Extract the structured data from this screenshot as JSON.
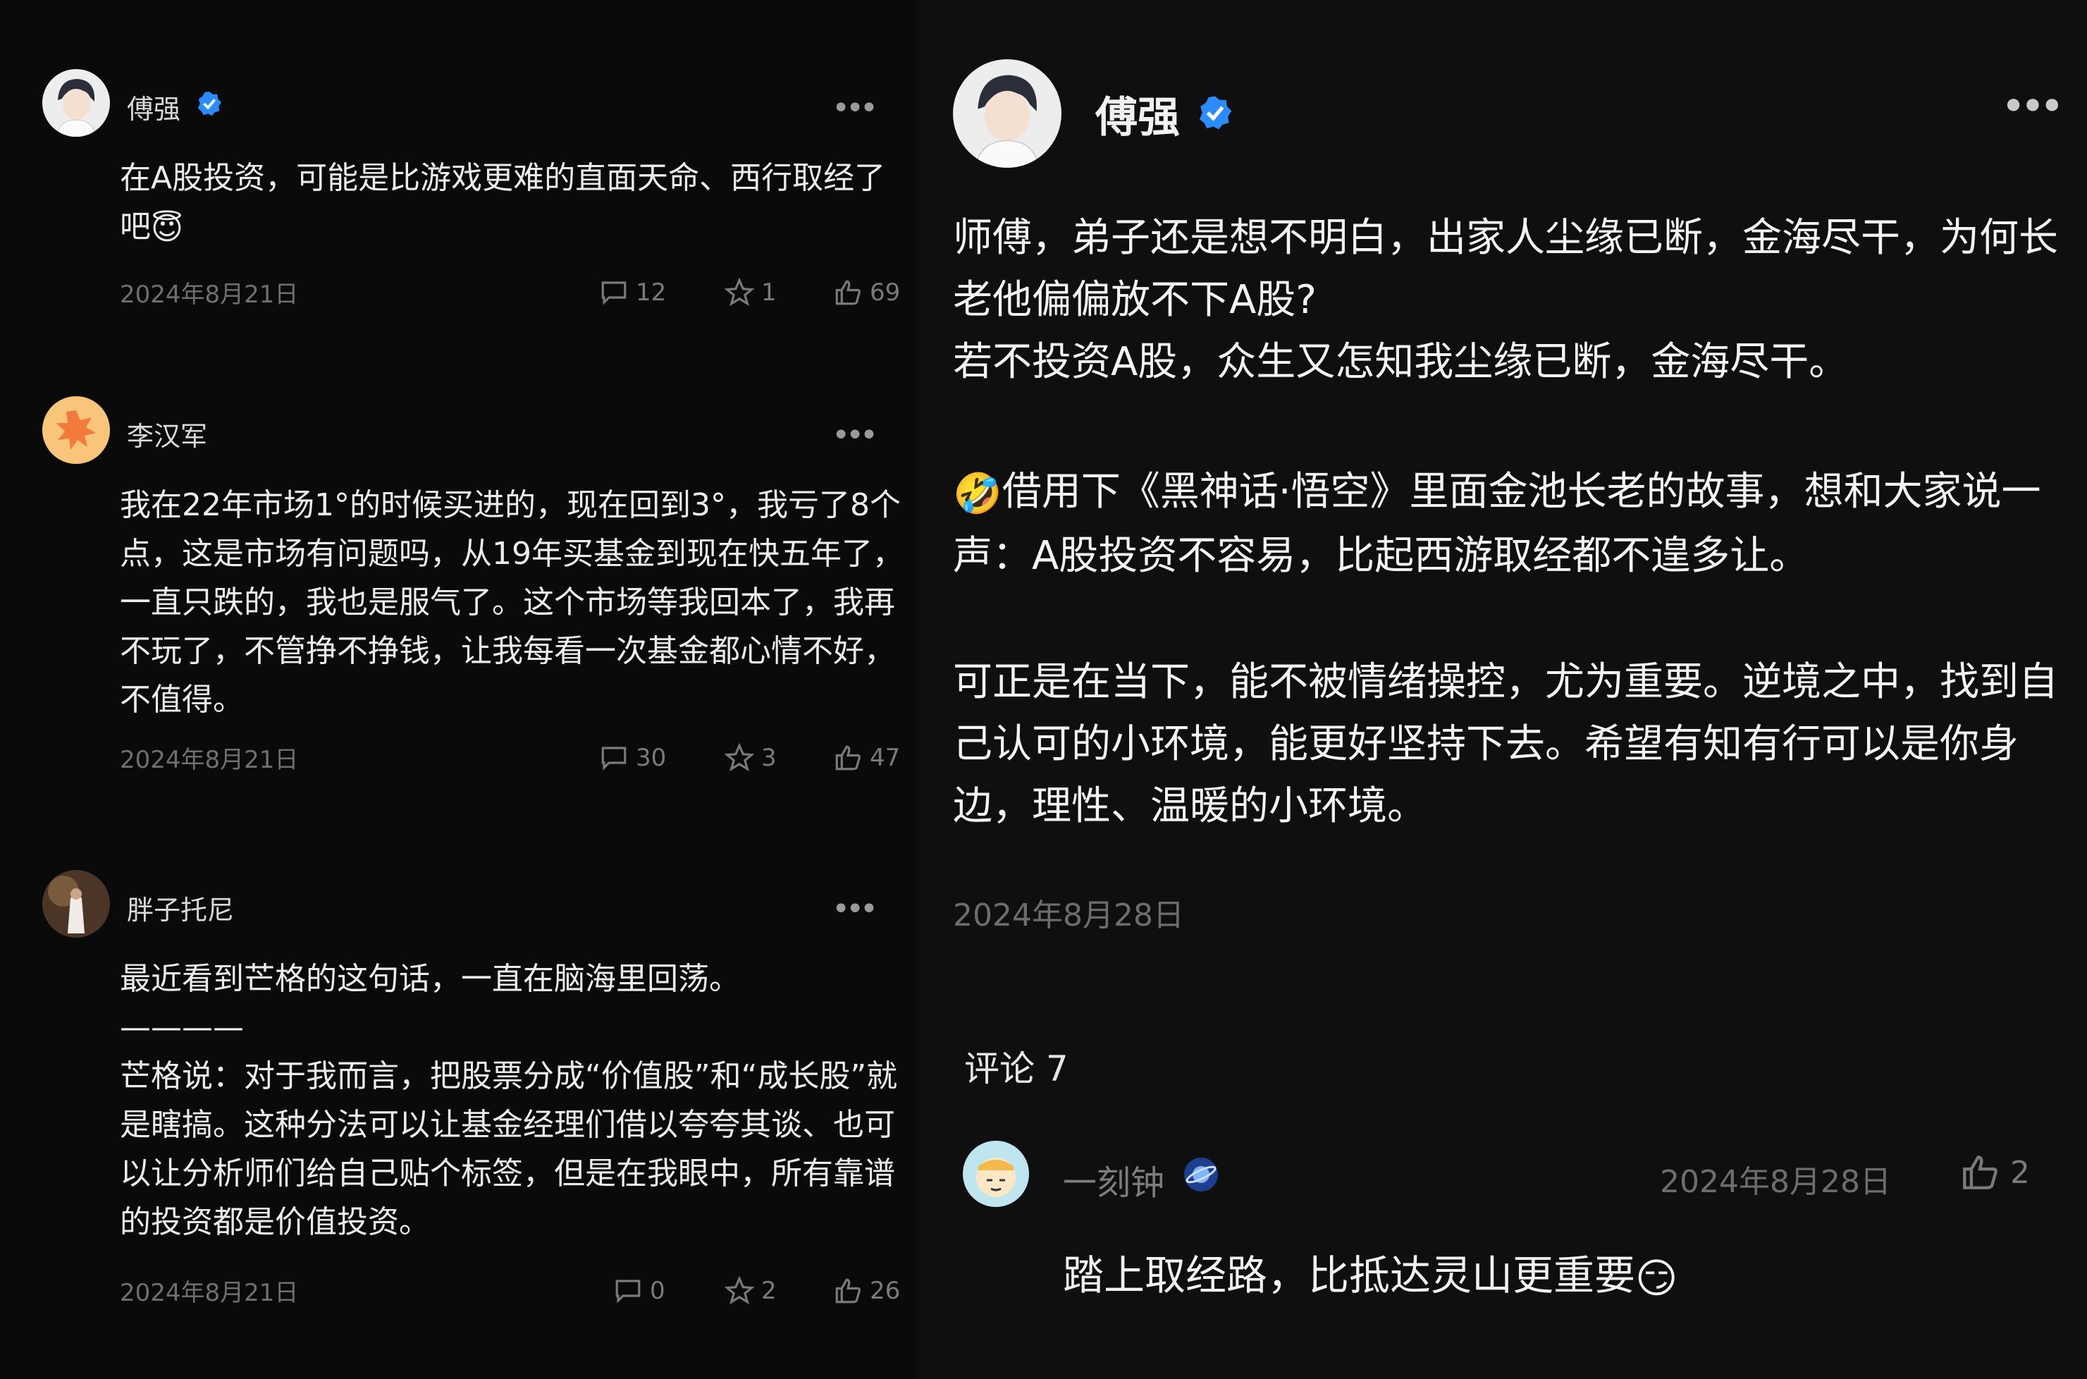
{
  "left_posts": [
    {
      "user": "傅强",
      "verified": true,
      "body": "在A股投资，可能是比游戏更难的直面天命、西行取经了吧",
      "body_emoji": "😇",
      "date": "2024年8月21日",
      "comments": "12",
      "stars": "1",
      "likes": "69"
    },
    {
      "user": "李汉军",
      "verified": false,
      "body": "我在22年市场1°的时候买进的，现在回到3°，我亏了8个点，这是市场有问题吗，从19年买基金到现在快五年了，一直只跌的，我也是服气了。这个市场等我回本了，我再不玩了，不管挣不挣钱，让我每看一次基金都心情不好，不值得。",
      "date": "2024年8月21日",
      "comments": "30",
      "stars": "3",
      "likes": "47"
    },
    {
      "user": "胖子托尼",
      "verified": false,
      "body": "最近看到芒格的这句话，一直在脑海里回荡。\n————\n芒格说：对于我而言，把股票分成“价值股”和“成长股”就是瞎搞。这种分法可以让基金经理们借以夸夸其谈、也可以让分析师们给自己贴个标签，但是在我眼中，所有靠谱的投资都是价值投资。",
      "date": "2024年8月21日",
      "comments": "0",
      "stars": "2",
      "likes": "26"
    }
  ],
  "right_post": {
    "user": "傅强",
    "verified": true,
    "para1": "师傅，弟子还是想不明白，出家人尘缘已断，金海尽干，为何长老他偏偏放不下A股?\n若不投资A股，众生又怎知我尘缘已断，金海尽干。",
    "para2_emoji": "🤣",
    "para2": "借用下《黑神话·悟空》里面金池长老的故事，想和大家说一声：A股投资不容易，比起西游取经都不遑多让。",
    "para3": "可正是在当下，能不被情绪操控，尤为重要。逆境之中，找到自己认可的小环境，能更好坚持下去。希望有知有行可以是你身边，理性、温暖的小环境。",
    "date": "2024年8月28日",
    "comments_title": "评论 7"
  },
  "comment": {
    "user": "一刻钟",
    "date": "2024年8月28日",
    "likes": "2",
    "text": "踏上取经路，比抵达灵山更重要",
    "emoji": "😏"
  },
  "colors": {
    "background": "#0b0b0b",
    "verified_blue": "#2b8cff",
    "muted": "#6f6f6f"
  },
  "icons": [
    "comment-icon",
    "star-icon",
    "thumbs-up-icon",
    "more-icon",
    "verified-badge-icon",
    "planet-badge-icon"
  ]
}
